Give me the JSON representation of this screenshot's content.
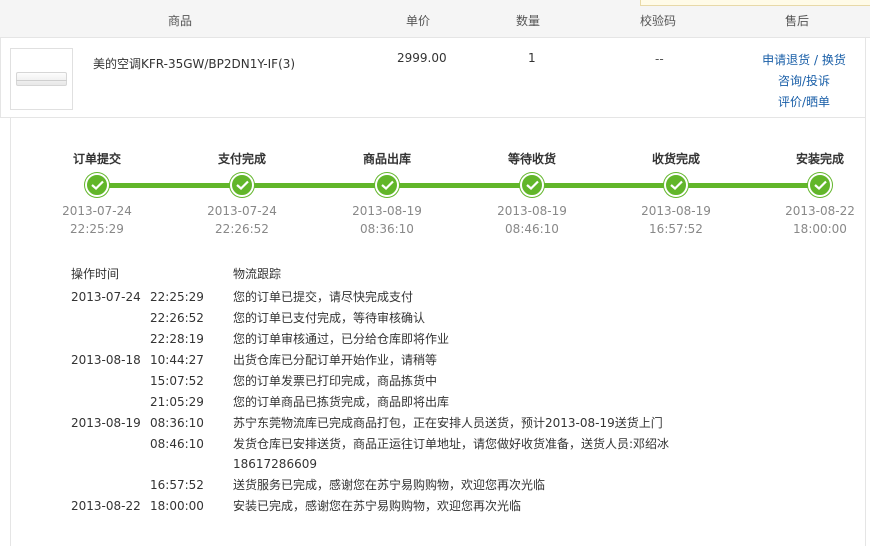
{
  "header": {
    "col_product": "商品",
    "col_price": "单价",
    "col_qty": "数量",
    "col_code": "校验码",
    "col_after": "售后"
  },
  "product": {
    "name": "美的空调KFR-35GW/BP2DN1Y-IF(3)",
    "price": "2999.00",
    "qty": "1",
    "code": "--",
    "links": {
      "return_exchange": "申请退货 / 换货",
      "consult": "咨询/投诉",
      "review": "评价/晒单"
    }
  },
  "progress": {
    "color": "#62b62a",
    "steps": [
      {
        "label": "订单提交",
        "date": "2013-07-24",
        "time": "22:25:29"
      },
      {
        "label": "支付完成",
        "date": "2013-07-24",
        "time": "22:26:52"
      },
      {
        "label": "商品出库",
        "date": "2013-08-19",
        "time": "08:36:10"
      },
      {
        "label": "等待收货",
        "date": "2013-08-19",
        "time": "08:46:10"
      },
      {
        "label": "收货完成",
        "date": "2013-08-19",
        "time": "16:57:52"
      },
      {
        "label": "安装完成",
        "date": "2013-08-22",
        "time": "18:00:00"
      }
    ]
  },
  "log": {
    "col_time": "操作时间",
    "col_track": "物流跟踪",
    "rows": [
      {
        "date": "2013-07-24",
        "time": "22:25:29",
        "msg": "您的订单已提交，请尽快完成支付"
      },
      {
        "date": "",
        "time": "22:26:52",
        "msg": "您的订单已支付完成，等待审核确认"
      },
      {
        "date": "",
        "time": "22:28:19",
        "msg": "您的订单审核通过，已分给仓库即将作业"
      },
      {
        "date": "2013-08-18",
        "time": "10:44:27",
        "msg": "出货仓库已分配订单开始作业，请稍等"
      },
      {
        "date": "",
        "time": "15:07:52",
        "msg": "您的订单发票已打印完成，商品拣货中"
      },
      {
        "date": "",
        "time": "21:05:29",
        "msg": "您的订单商品已拣货完成，商品即将出库"
      },
      {
        "date": "2013-08-19",
        "time": "08:36:10",
        "msg": "苏宁东莞物流库已完成商品打包，正在安排人员送货，预计2013-08-19送货上门"
      },
      {
        "date": "",
        "time": "08:46:10",
        "msg": "发货仓库已安排送货，商品正运往订单地址，请您做好收货准备，送货人员:邓绍冰 18617286609"
      },
      {
        "date": "",
        "time": "16:57:52",
        "msg": "送货服务已完成，感谢您在苏宁易购购物，欢迎您再次光临"
      },
      {
        "date": "2013-08-22",
        "time": "18:00:00",
        "msg": "安装已完成，感谢您在苏宁易购购物，欢迎您再次光临"
      }
    ]
  }
}
